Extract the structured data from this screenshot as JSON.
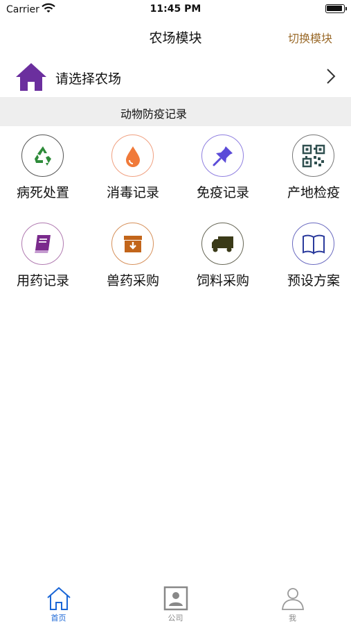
{
  "status_bar": {
    "carrier": "Carrier",
    "time": "11:45 PM"
  },
  "nav": {
    "title": "农场模块",
    "switch_label": "切换模块"
  },
  "farm_selector": {
    "label": "请选择农场",
    "icon": "house-icon"
  },
  "section": {
    "title": "动物防疫记录"
  },
  "grid": [
    {
      "label": "病死处置",
      "icon": "recycle-icon",
      "color": "#2e8b3a",
      "border": "#555555"
    },
    {
      "label": "消毒记录",
      "icon": "drop-icon",
      "color": "#f07a3a",
      "border": "#f0a080"
    },
    {
      "label": "免疫记录",
      "icon": "pushpin-icon",
      "color": "#5b4bd8",
      "border": "#8f7fe0"
    },
    {
      "label": "产地检疫",
      "icon": "qr-code-icon",
      "color": "#2f4f4f",
      "border": "#777777"
    },
    {
      "label": "用药记录",
      "icon": "book-icon",
      "color": "#7a2a8c",
      "border": "#b07ab0"
    },
    {
      "label": "兽药采购",
      "icon": "archive-box-icon",
      "color": "#c2651a",
      "border": "#d6905a"
    },
    {
      "label": "饲料采购",
      "icon": "truck-icon",
      "color": "#3a3a18",
      "border": "#666655"
    },
    {
      "label": "预设方案",
      "icon": "open-book-icon",
      "color": "#2a3a9c",
      "border": "#6a6ac0"
    }
  ],
  "tabs": [
    {
      "label": "首页",
      "icon": "home-tab-icon",
      "active": true
    },
    {
      "label": "公司",
      "icon": "contact-card-icon",
      "active": false
    },
    {
      "label": "我",
      "icon": "person-icon",
      "active": false
    }
  ],
  "colors": {
    "accent": "#1a66d6",
    "inactive": "#888888",
    "switch": "#9a6a2a",
    "house": "#6b2f9e"
  }
}
